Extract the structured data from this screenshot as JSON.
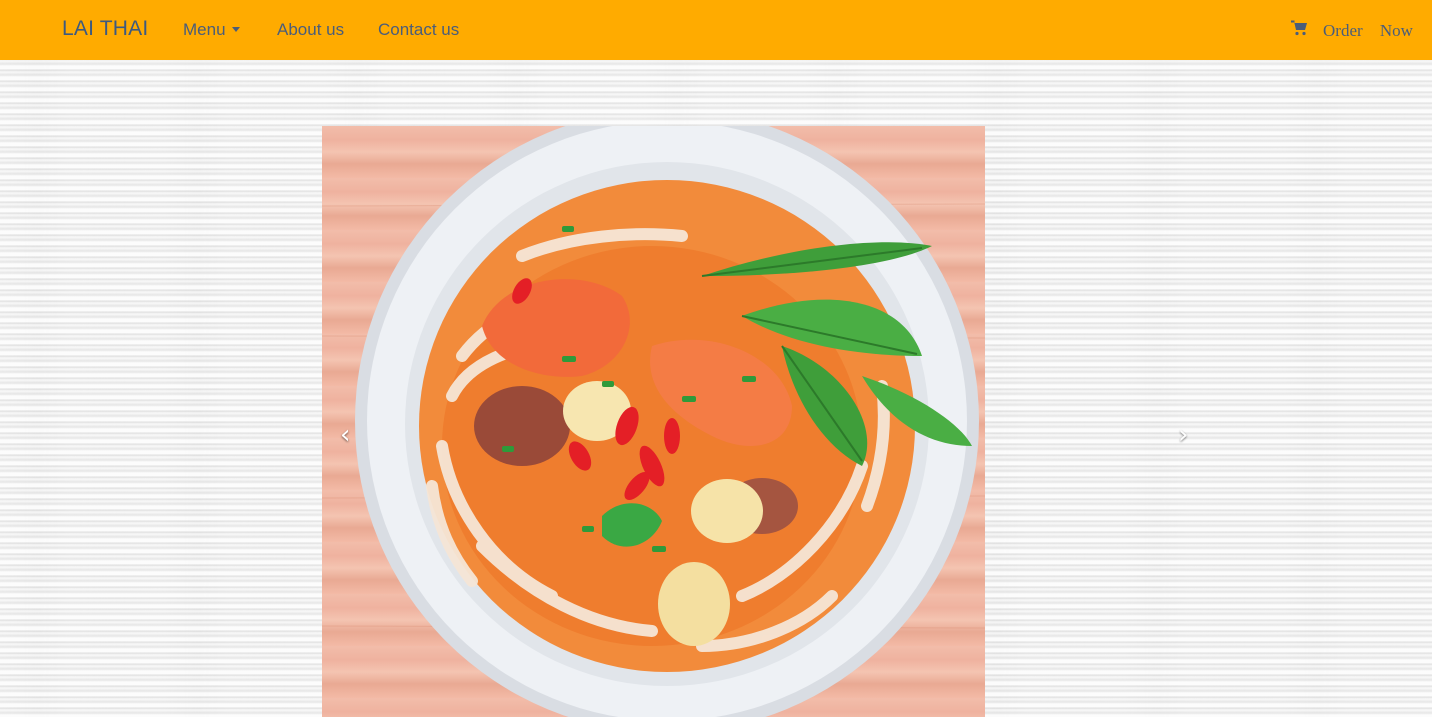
{
  "navbar": {
    "brand": "LAI THAI",
    "links": [
      {
        "label": "Menu",
        "has_dropdown": true
      },
      {
        "label": "About us"
      },
      {
        "label": "Contact us"
      }
    ],
    "cart_icon": "shopping-cart-icon",
    "order_label": "Order Now"
  },
  "carousel": {
    "prev_symbol": "‹",
    "next_symbol": "›",
    "slide_icon": "noodle-soup-photo"
  },
  "colors": {
    "navbar_bg": "#ffab00",
    "nav_text": "#4a5d7a",
    "brand_text": "#3d5a80"
  }
}
